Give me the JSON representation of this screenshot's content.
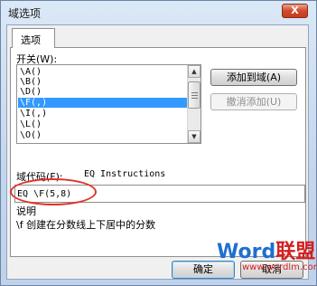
{
  "window": {
    "title": "域选项",
    "close_label": "X"
  },
  "tab": {
    "label": "选项"
  },
  "switches": {
    "label": "开关(W):",
    "items": [
      "\\A()",
      "\\B()",
      "\\D()",
      "\\F(,)",
      "\\I(,)",
      "\\L()",
      "\\O()"
    ],
    "selected_index": 3
  },
  "buttons": {
    "add_to_field": "添加到域(A)",
    "undo_add": "撤消添加(U)",
    "ok": "确定",
    "cancel": "取消"
  },
  "field_code": {
    "label": "域代码(F):",
    "instructions": "EQ Instructions",
    "value": "EQ \\F(5,8)"
  },
  "description": {
    "label": "说明",
    "text": "\\f 创建在分数线上下居中的分数"
  },
  "watermark": {
    "word": "Word",
    "word_color": "#1f6fd0",
    "suffix": "联盟",
    "suffix_color": "#d31f1f",
    "url": "www.wordlm.com"
  },
  "colors": {
    "selection": "#3399ff",
    "highlight_circle": "#e0332a"
  }
}
